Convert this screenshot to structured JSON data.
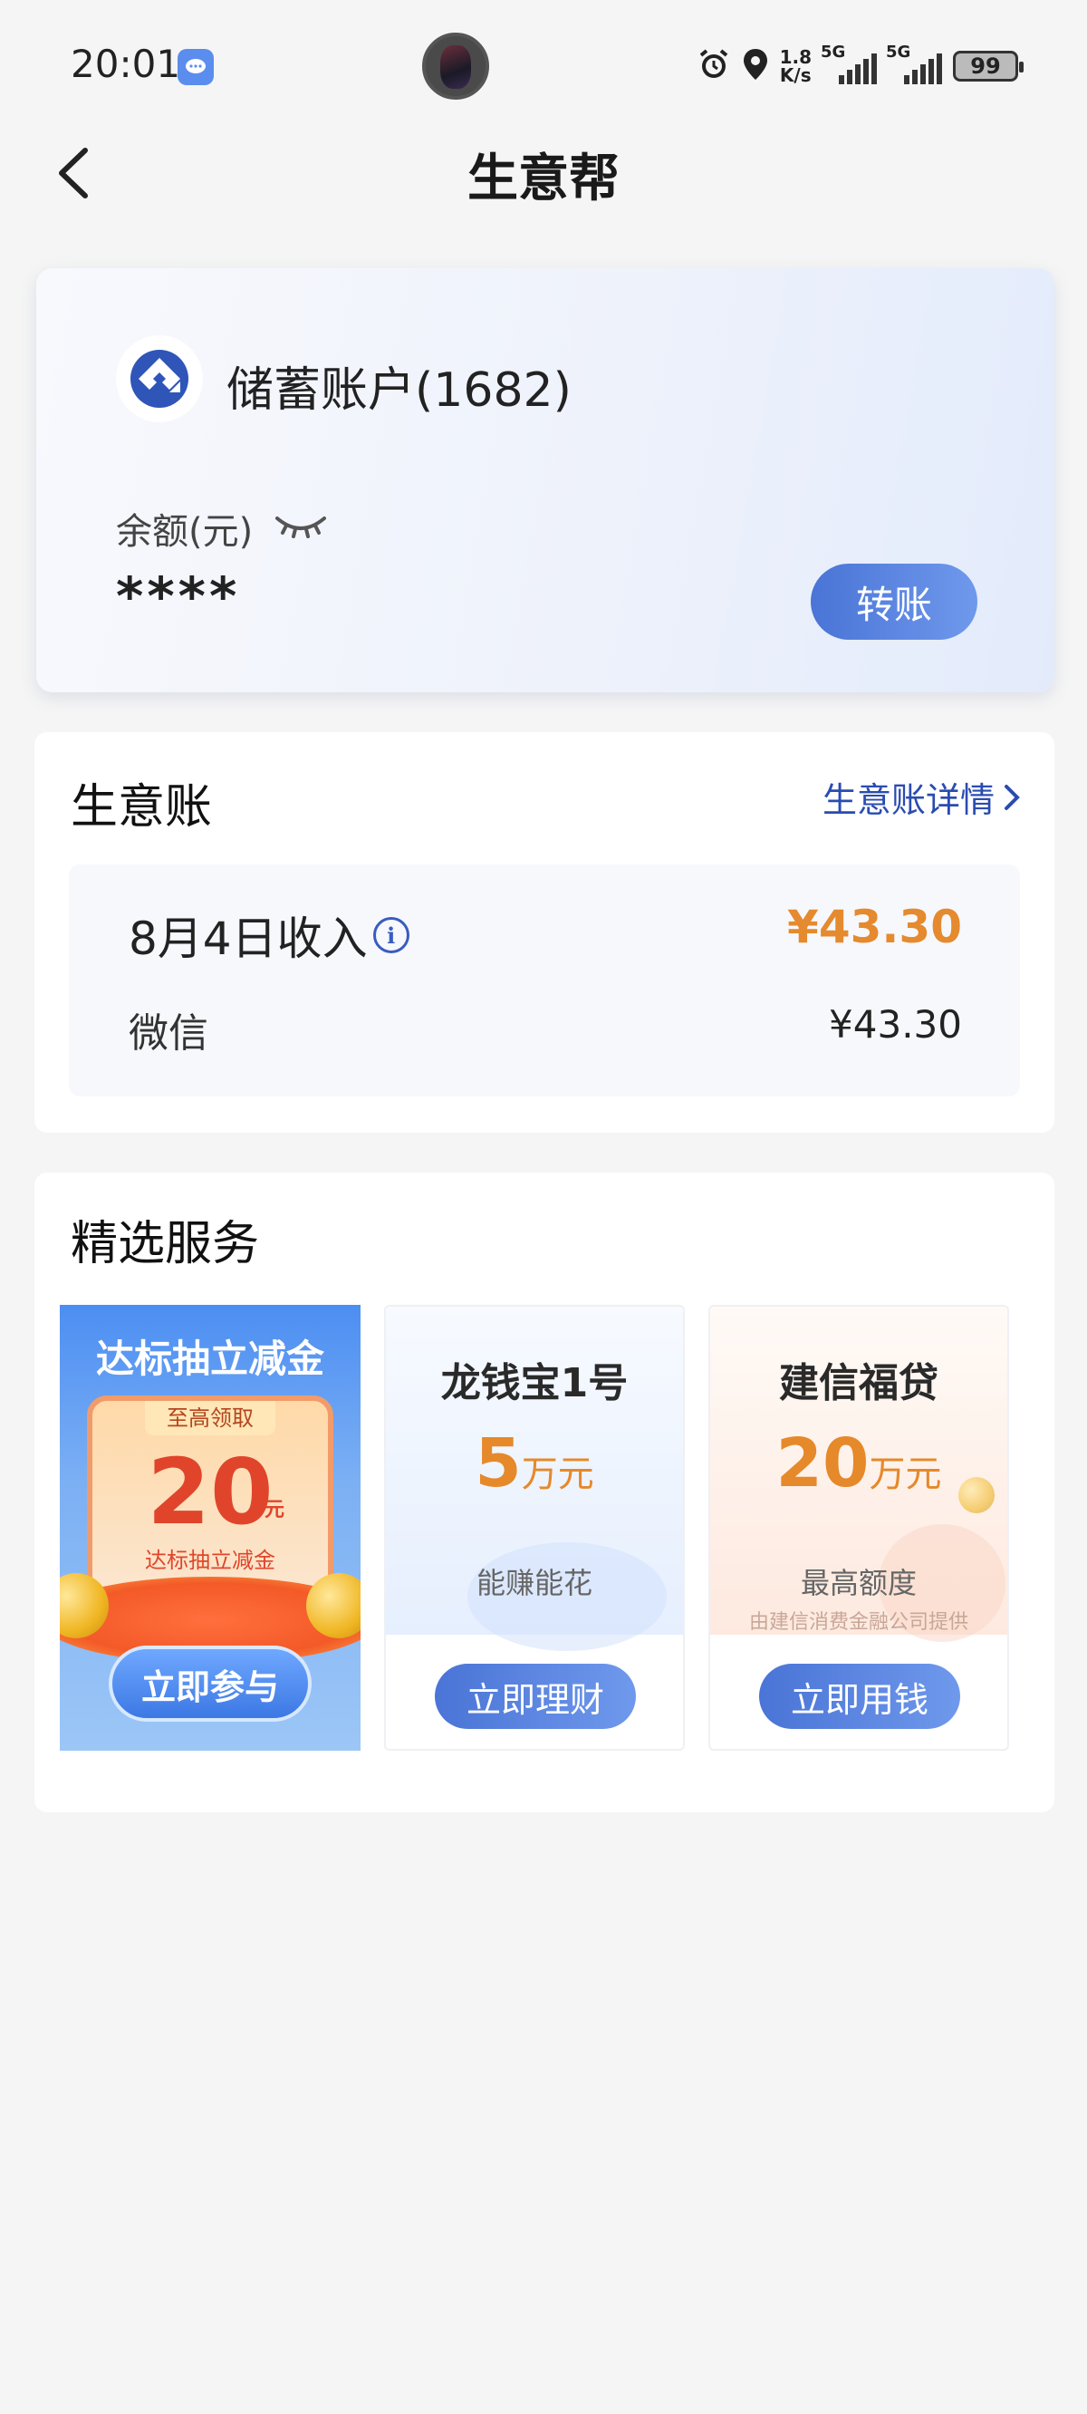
{
  "status_bar": {
    "time": "20:01",
    "net_speed_value": "1.8",
    "net_speed_unit": "K/s",
    "sig1_label": "5G",
    "sig2_label": "5G",
    "battery": "99"
  },
  "header": {
    "title": "生意帮"
  },
  "account": {
    "name": "储蓄账户(1682)",
    "balance_label": "余额(元)",
    "balance_value": "****",
    "transfer_label": "转账"
  },
  "ledger": {
    "title": "生意账",
    "detail_link": "生意账详情",
    "income_label": "8月4日收入",
    "income_amount": "¥43.30",
    "rows": [
      {
        "label": "微信",
        "amount": "¥43.30"
      }
    ]
  },
  "services": {
    "title": "精选服务",
    "promo": {
      "title": "达标抽立减金",
      "tag": "至高领取",
      "amount": "20",
      "unit": "元",
      "sub": "达标抽立减金",
      "button": "立即参与"
    },
    "items": [
      {
        "name": "龙钱宝1号",
        "amount": "5",
        "unit": "万元",
        "desc": "能赚能花",
        "note": "",
        "button": "立即理财"
      },
      {
        "name": "建信福贷",
        "amount": "20",
        "unit": "万元",
        "desc": "最高额度",
        "note": "由建信消费金融公司提供",
        "button": "立即用钱"
      }
    ]
  },
  "colors": {
    "accent_blue": "#4a74d6",
    "link_blue": "#2a4cb0",
    "amount_orange": "#e58a2e"
  }
}
